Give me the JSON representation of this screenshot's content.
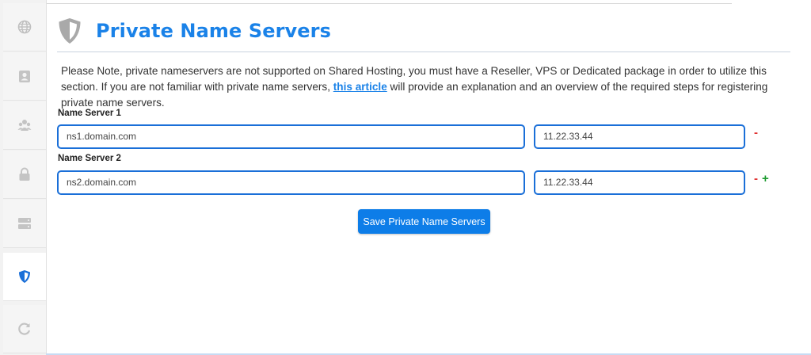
{
  "sidebar": {
    "items": [
      {
        "name": "globe-icon"
      },
      {
        "name": "contact-card-icon"
      },
      {
        "name": "users-icon"
      },
      {
        "name": "lock-icon"
      },
      {
        "name": "server-icon"
      },
      {
        "name": "shield-icon",
        "active": true
      },
      {
        "name": "refresh-icon"
      }
    ]
  },
  "page": {
    "title": "Private Name Servers",
    "note_before": "Please Note, private nameservers are not supported on Shared Hosting, you must have a Reseller, VPS or Dedicated package in order to utilize this section. If you are not familiar with private name servers, ",
    "note_link": "this article",
    "note_after": " will provide an explanation and an overview of the required steps for registering private name servers."
  },
  "name_servers": [
    {
      "label": "Name Server 1",
      "host": "ns1.domain.com",
      "ip": "11.22.33.44",
      "remove": "-"
    },
    {
      "label": "Name Server 2",
      "host": "ns2.domain.com",
      "ip": "11.22.33.44",
      "remove": "-",
      "add": "+"
    }
  ],
  "actions": {
    "save_label": "Save Private Name Servers"
  },
  "colors": {
    "accent": "#1a82e8",
    "remove": "#e03131",
    "add": "#1e9b31"
  }
}
